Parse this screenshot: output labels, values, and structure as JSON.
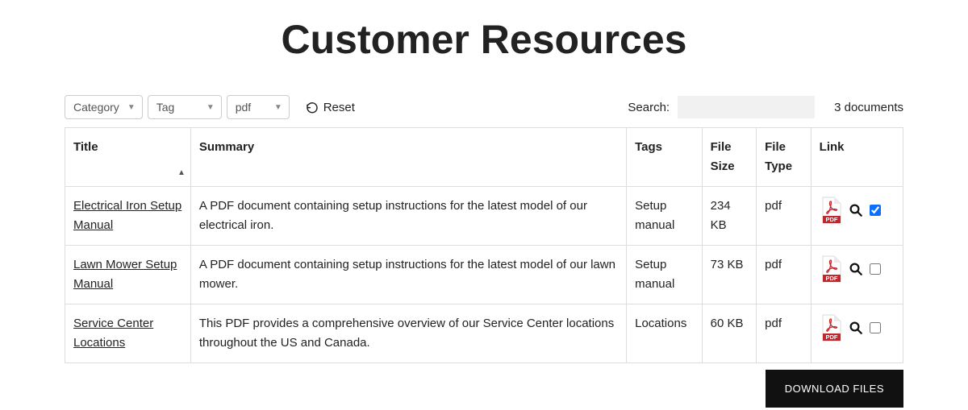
{
  "page": {
    "title": "Customer Resources"
  },
  "filters": {
    "category": {
      "selected": "Category"
    },
    "tag": {
      "selected": "Tag"
    },
    "filetype": {
      "selected": "pdf"
    },
    "reset_label": "Reset"
  },
  "search": {
    "label": "Search:",
    "value": ""
  },
  "document_count_text": "3 documents",
  "columns": {
    "title": "Title",
    "summary": "Summary",
    "tags": "Tags",
    "file_size": "File Size",
    "file_type": "File Type",
    "link": "Link"
  },
  "rows": [
    {
      "title": "Electrical Iron Setup Manual",
      "summary": "A PDF document containing setup instructions for the latest model of our electrical iron.",
      "tags": "Setup manual",
      "file_size": "234 KB",
      "file_type": "pdf",
      "checked": true
    },
    {
      "title": "Lawn Mower Setup Manual",
      "summary": "A PDF document containing setup instructions for the latest model of our lawn mower.",
      "tags": "Setup manual",
      "file_size": "73 KB",
      "file_type": "pdf",
      "checked": false
    },
    {
      "title": "Service Center Locations",
      "summary": "This PDF provides a comprehensive overview of our Service Center locations throughout the US and Canada.",
      "tags": "Locations",
      "file_size": "60 KB",
      "file_type": "pdf",
      "checked": false
    }
  ],
  "actions": {
    "download_label": "DOWNLOAD FILES"
  }
}
